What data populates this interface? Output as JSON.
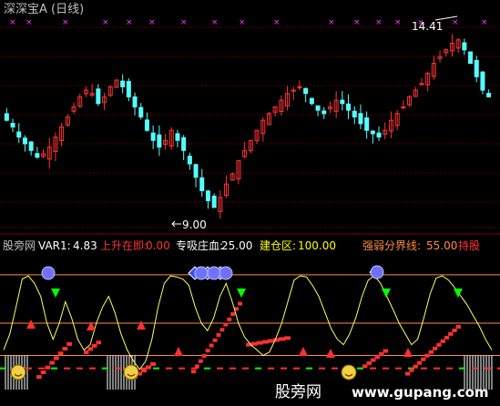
{
  "header": {
    "title": "深深宝A (日线)"
  },
  "price_labels": {
    "high": "14.41",
    "low": "9.00"
  },
  "indicator_bar": {
    "name": "股旁网",
    "var1_label": "VAR1:",
    "var1_value": "4.83",
    "rise_label": "上升在即:",
    "rise_value": "0.00",
    "absorb_label": "专吸庄血:",
    "absorb_value": "25.00",
    "build_label": "建仓区:",
    "build_value": "100.00",
    "divide_label": "强弱分界线:",
    "divide_value": "55.00",
    "hold_label": "持股"
  },
  "watermark": {
    "cn": "股旁网",
    "url": "www.gupang.com"
  },
  "colors": {
    "up": "#ff3333",
    "down": "#54ffff",
    "grid": "#8b0000",
    "title": "#c0c0c0",
    "accent_red": "#ff3030",
    "yellow": "#ffff00",
    "magenta": "#ff33ff",
    "green": "#00ff00",
    "orange": "#ff8c40"
  },
  "chart_data": [
    {
      "type": "candlestick",
      "title": "深深宝A (日线)",
      "y_range": [
        8.6,
        14.9
      ],
      "annotations": [
        {
          "text": "14.41",
          "kind": "high"
        },
        {
          "text": "9.00",
          "kind": "low"
        }
      ],
      "closes": [
        11.8,
        11.6,
        11.3,
        11.1,
        10.9,
        10.7,
        10.8,
        11.0,
        11.3,
        11.6,
        11.9,
        12.2,
        12.5,
        12.7,
        12.6,
        12.3,
        12.5,
        12.8,
        13.0,
        12.8,
        12.5,
        12.2,
        11.9,
        11.5,
        11.2,
        11.0,
        11.2,
        11.5,
        11.2,
        10.9,
        10.5,
        10.1,
        9.7,
        9.4,
        9.2,
        9.5,
        9.9,
        10.2,
        10.6,
        10.9,
        11.2,
        11.5,
        11.8,
        12.0,
        12.2,
        12.4,
        12.6,
        12.7,
        12.8,
        12.6,
        12.3,
        12.1,
        12.0,
        12.2,
        12.4,
        12.3,
        12.1,
        11.9,
        11.7,
        11.5,
        11.4,
        11.3,
        11.5,
        11.8,
        12.0,
        12.2,
        12.5,
        12.7,
        12.9,
        13.2,
        13.5,
        13.7,
        13.9,
        14.1,
        14.2,
        13.9,
        13.5,
        13.1,
        12.7,
        12.5
      ]
    },
    {
      "type": "line",
      "title": "股旁网",
      "y_range": [
        0,
        110
      ],
      "reference_lines": [
        25,
        55,
        100
      ],
      "series": [
        {
          "name": "VAR1",
          "values": [
            30,
            45,
            70,
            96,
            99,
            92,
            80,
            55,
            40,
            55,
            75,
            60,
            40,
            30,
            35,
            55,
            70,
            80,
            65,
            45,
            30,
            20,
            12,
            20,
            40,
            70,
            92,
            99,
            98,
            96,
            90,
            70,
            55,
            48,
            60,
            80,
            92,
            75,
            55,
            42,
            35,
            30,
            25,
            28,
            40,
            55,
            75,
            95,
            99,
            98,
            90,
            80,
            65,
            50,
            40,
            35,
            45,
            60,
            80,
            95,
            99,
            92,
            80,
            68,
            55,
            45,
            35,
            40,
            60,
            82,
            97,
            99,
            95,
            88,
            80,
            72,
            62,
            52,
            40,
            30
          ]
        }
      ]
    }
  ]
}
